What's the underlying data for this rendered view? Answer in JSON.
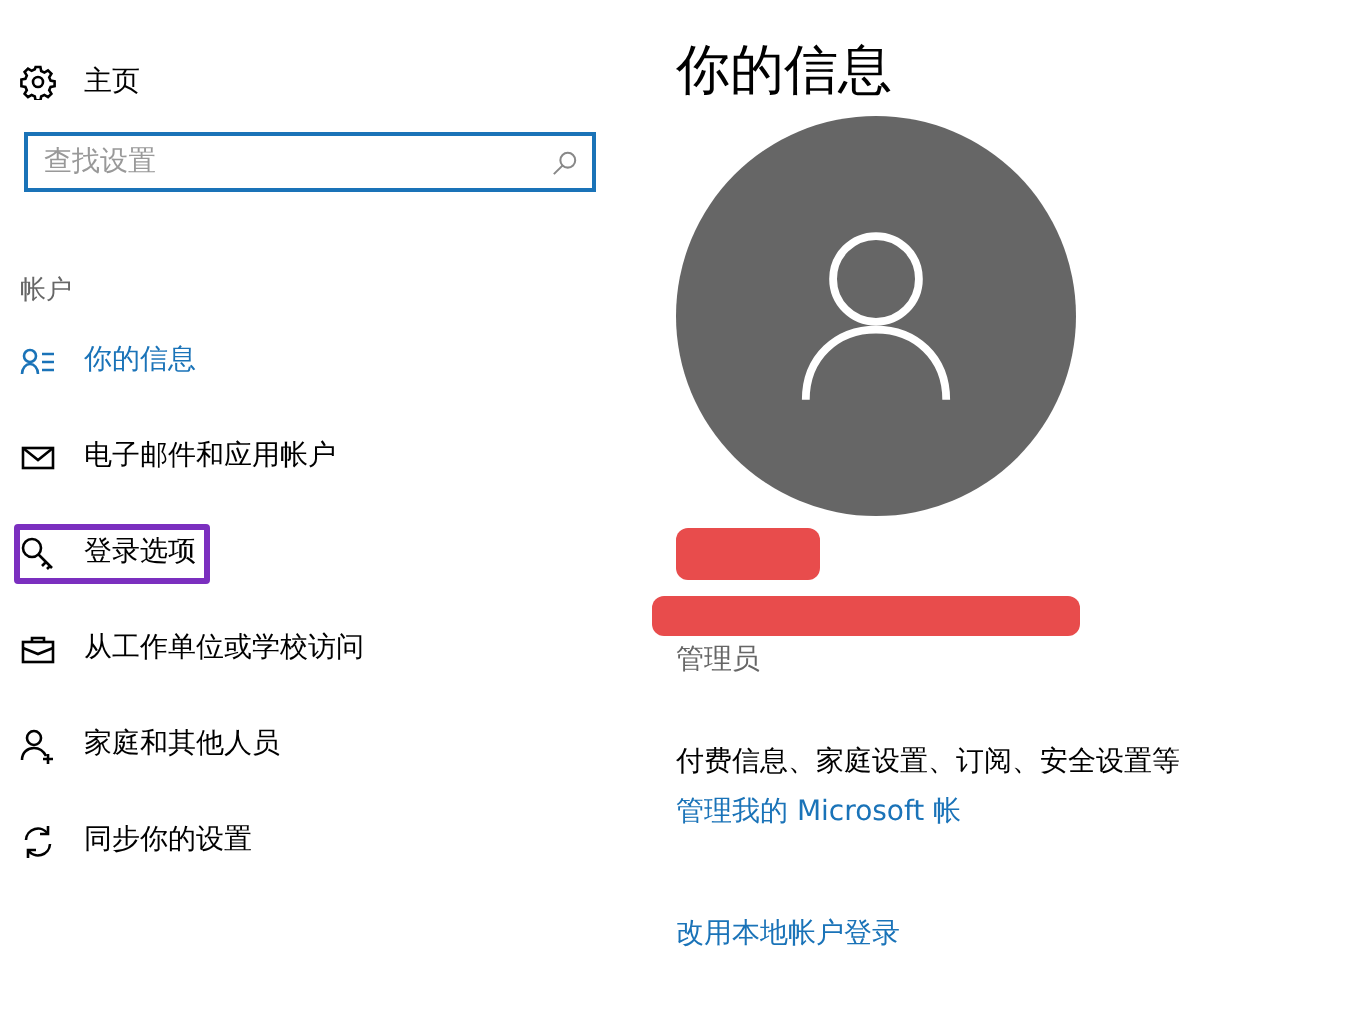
{
  "sidebar": {
    "home": {
      "label": "主页"
    },
    "search": {
      "placeholder": "查找设置"
    },
    "section": "帐户",
    "items": [
      {
        "label": "你的信息",
        "selected": true,
        "highlighted": false
      },
      {
        "label": "电子邮件和应用帐户",
        "selected": false,
        "highlighted": false
      },
      {
        "label": "登录选项",
        "selected": false,
        "highlighted": true
      },
      {
        "label": "从工作单位或学校访问",
        "selected": false,
        "highlighted": false
      },
      {
        "label": "家庭和其他人员",
        "selected": false,
        "highlighted": false
      },
      {
        "label": "同步你的设置",
        "selected": false,
        "highlighted": false
      }
    ]
  },
  "main": {
    "title": "你的信息",
    "redactions": [
      {
        "kind": "short"
      },
      {
        "kind": "long"
      }
    ],
    "role": "管理员",
    "description": "付费信息、家庭设置、订阅、安全设置等",
    "links": [
      "管理我的 Microsoft 帐",
      "改用本地帐户登录"
    ]
  }
}
